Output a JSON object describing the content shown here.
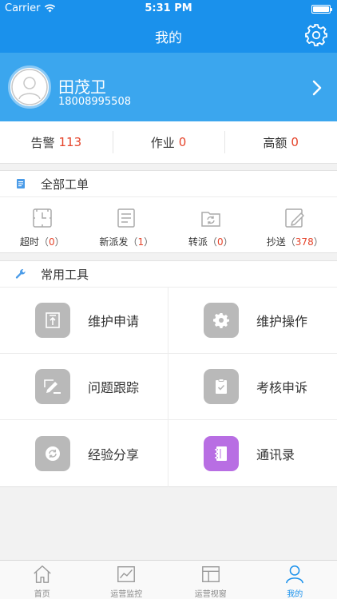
{
  "status_bar": {
    "carrier": "Carrier",
    "time": "5:31 PM"
  },
  "nav": {
    "title": "我的",
    "settings_icon": "gear-icon"
  },
  "profile": {
    "name": "田茂卫",
    "phone": "18008995508"
  },
  "stats": [
    {
      "label": "告警",
      "value": "113"
    },
    {
      "label": "作业",
      "value": "0"
    },
    {
      "label": "高额",
      "value": "0"
    }
  ],
  "orders_section": {
    "title": "全部工单",
    "items": [
      {
        "label": "超时",
        "open": "（",
        "count": "0",
        "close": "）"
      },
      {
        "label": "新派发",
        "open": "（",
        "count": "1",
        "close": "）"
      },
      {
        "label": "转派",
        "open": "（",
        "count": "0",
        "close": "）"
      },
      {
        "label": "抄送",
        "open": "（",
        "count": "378",
        "close": "）"
      }
    ]
  },
  "tools_section": {
    "title": "常用工具",
    "items": [
      {
        "label": "维护申请"
      },
      {
        "label": "维护操作"
      },
      {
        "label": "问题跟踪"
      },
      {
        "label": "考核申诉"
      },
      {
        "label": "经验分享"
      },
      {
        "label": "通讯录"
      }
    ]
  },
  "tabs": [
    {
      "label": "首页"
    },
    {
      "label": "运营监控"
    },
    {
      "label": "运营视窗"
    },
    {
      "label": "我的"
    }
  ],
  "colors": {
    "primary": "#1a91ec",
    "header_bg": "#3ba6ee",
    "count_red": "#e5442b",
    "tool_gray": "#b9b9b9",
    "tool_purple": "#b86ee3"
  }
}
